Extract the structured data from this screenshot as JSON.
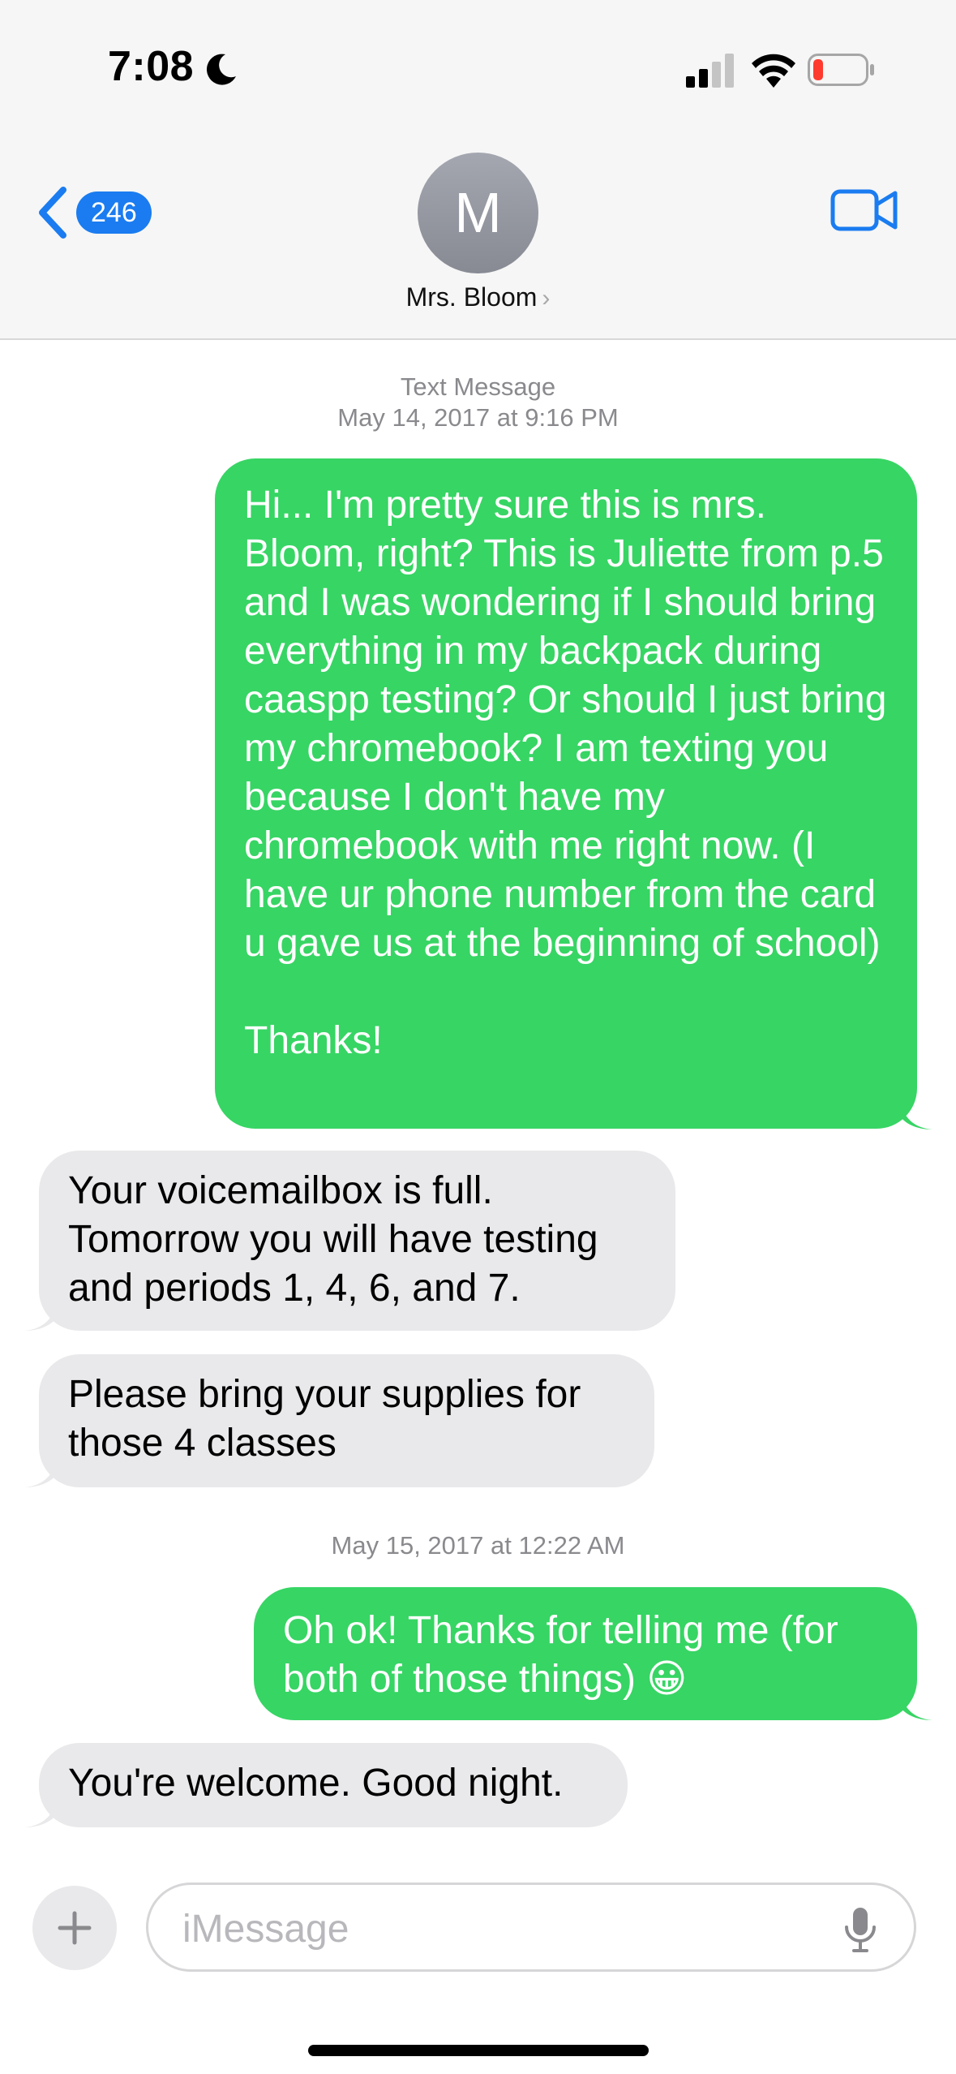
{
  "status_bar": {
    "time": "7:08",
    "icons": [
      "moon-icon",
      "cellular-signal-icon",
      "wifi-icon",
      "battery-low-icon"
    ]
  },
  "header": {
    "back_badge": "246",
    "avatar_initial": "M",
    "contact_name": "Mrs. Bloom",
    "icons": [
      "chevron-left-icon",
      "video-camera-icon",
      "chevron-right-icon"
    ],
    "accent_color": "#1a7cf0"
  },
  "thread": {
    "stamp1": {
      "label": "Text Message",
      "date": "May 14, 2017",
      "time": "at 9:16 PM"
    },
    "stamp2": {
      "date": "May 15, 2017",
      "time": "at 12:22 AM"
    },
    "messages": [
      {
        "direction": "sent",
        "text": "Hi... I'm pretty sure this is mrs. Bloom, right? This is Juliette from p.5 and I was wondering if I should bring everything in my backpack during caaspp testing? Or should I just bring my chromebook? I am texting you because I don't have my chromebook with me right now. (I have ur phone number from the card u gave us at the beginning of school)\n\nThanks!"
      },
      {
        "direction": "received",
        "text": "Your voicemailbox is full. Tomorrow you will have testing and periods 1, 4, 6, and 7."
      },
      {
        "direction": "received",
        "text": "Please bring your supplies for those 4 classes"
      },
      {
        "direction": "sent",
        "text": "Oh ok! Thanks for telling me (for both of those things) 😀"
      },
      {
        "direction": "received",
        "text": "You're welcome. Good night."
      }
    ],
    "colors": {
      "sent_bubble": "#37d564",
      "received_bubble": "#e9e9eb"
    }
  },
  "composer": {
    "placeholder": "iMessage",
    "icons": [
      "plus-icon",
      "microphone-icon"
    ]
  }
}
